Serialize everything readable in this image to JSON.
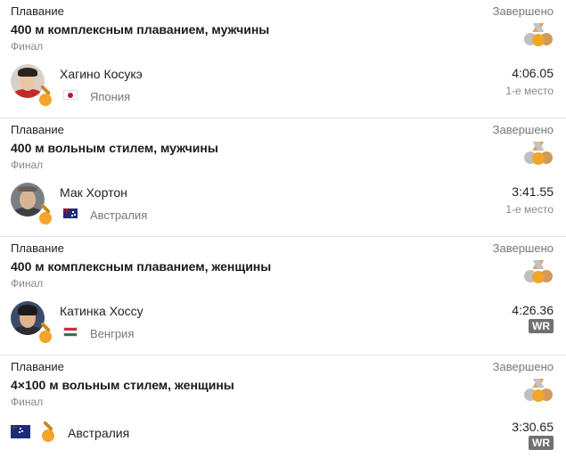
{
  "cards": [
    {
      "sport": "Плавание",
      "status": "Завершено",
      "event": "400 м комплексным плаванием, мужчины",
      "round": "Финал",
      "athlete": "Хагино Косукэ",
      "country": "Япония",
      "result": "4:06.05",
      "place": "1-е место"
    },
    {
      "sport": "Плавание",
      "status": "Завершено",
      "event": "400 м вольным стилем, мужчины",
      "round": "Финал",
      "athlete": "Мак Хортон",
      "country": "Австралия",
      "result": "3:41.55",
      "place": "1-е место"
    },
    {
      "sport": "Плавание",
      "status": "Завершено",
      "event": "400 м комплексным плаванием, женщины",
      "round": "Финал",
      "athlete": "Катинка Хоссу",
      "country": "Венгрия",
      "result": "4:26.36",
      "badge": "WR"
    },
    {
      "sport": "Плавание",
      "status": "Завершено",
      "event": "4×100 м вольным стилем, женщины",
      "round": "Финал",
      "country": "Австралия",
      "result": "3:30.65",
      "badge": "WR"
    }
  ],
  "icons": {
    "medals": "medals-icon",
    "gold_medal": "gold-medal-icon"
  },
  "colors": {
    "gold": "#f2a52b",
    "silver": "#bfbfbf",
    "bronze": "#d19a5a",
    "wr_badge": "#707070"
  }
}
